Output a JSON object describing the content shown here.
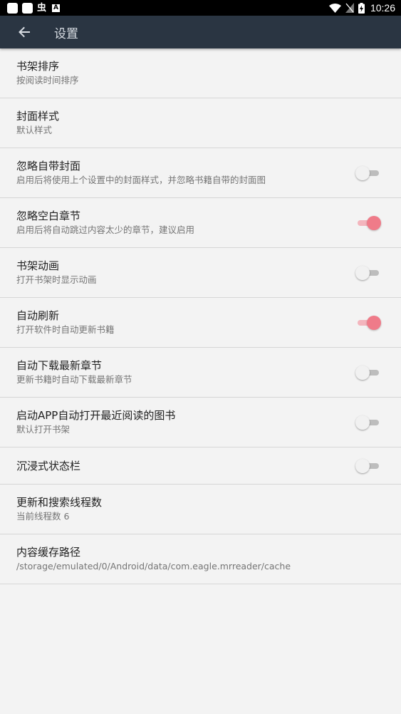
{
  "status_bar": {
    "time": "10:26",
    "left_icons": [
      "notification-square-icon",
      "notification-square-icon",
      "bug-app-icon",
      "a-app-icon"
    ],
    "bug_glyph": "虫",
    "a_glyph": "A",
    "right_icons": [
      "wifi-icon",
      "no-sim-icon",
      "battery-charging-icon"
    ]
  },
  "app_bar": {
    "title": "设置",
    "back_icon": "arrow-back-icon",
    "background": "#2a3542"
  },
  "colors": {
    "switch_on_thumb": "#ef7b89",
    "switch_on_track": "#f3b5bd",
    "switch_off_thumb": "#f1f1f1",
    "switch_off_track": "#bdbdbd"
  },
  "settings": [
    {
      "title": "书架排序",
      "subtitle": "按阅读时间排序"
    },
    {
      "title": "封面样式",
      "subtitle": "默认样式"
    },
    {
      "title": "忽略自带封面",
      "subtitle": "启用后将使用上个设置中的封面样式，并忽略书籍自带的封面图",
      "toggle": false
    },
    {
      "title": "忽略空白章节",
      "subtitle": "启用后将自动跳过内容太少的章节，建议启用",
      "toggle": true
    },
    {
      "title": "书架动画",
      "subtitle": "打开书架时显示动画",
      "toggle": false
    },
    {
      "title": "自动刷新",
      "subtitle": "打开软件时自动更新书籍",
      "toggle": true
    },
    {
      "title": "自动下载最新章节",
      "subtitle": "更新书籍时自动下载最新章节",
      "toggle": false
    },
    {
      "title": "启动APP自动打开最近阅读的图书",
      "subtitle": "默认打开书架",
      "toggle": false
    },
    {
      "title": "沉浸式状态栏",
      "toggle": false
    },
    {
      "title": "更新和搜索线程数",
      "subtitle": "当前线程数 6"
    },
    {
      "title": "内容缓存路径",
      "subtitle": "/storage/emulated/0/Android/data/com.eagle.mrreader/cache"
    }
  ]
}
